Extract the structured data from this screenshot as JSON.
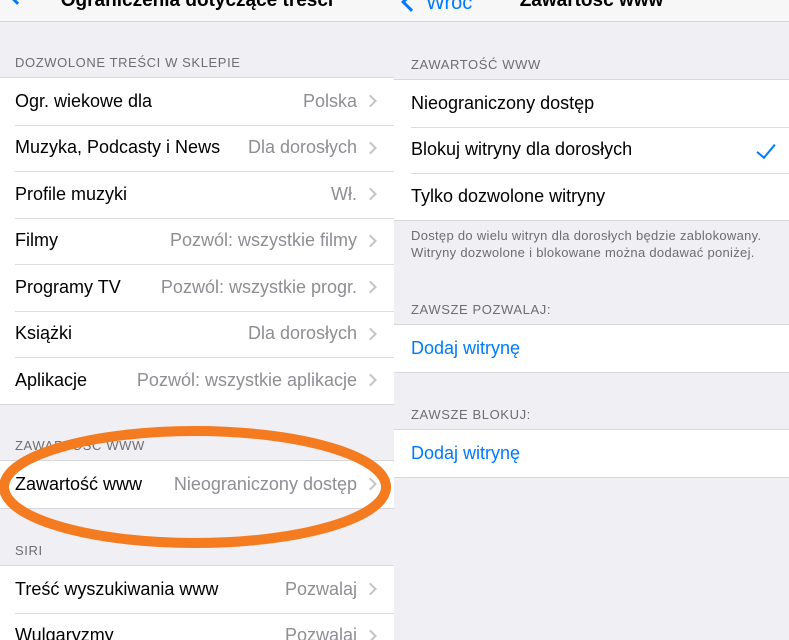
{
  "left": {
    "title": "Ograniczenia dotyczące treści",
    "store_section": {
      "header": "DOZWOLONE TREŚCI W SKLEPIE",
      "rows": [
        {
          "label": "Ogr. wiekowe dla",
          "value": "Polska"
        },
        {
          "label": "Muzyka, Podcasty i News",
          "value": "Dla dorosłych"
        },
        {
          "label": "Profile muzyki",
          "value": "Wł."
        },
        {
          "label": "Filmy",
          "value": "Pozwól: wszystkie filmy"
        },
        {
          "label": "Programy TV",
          "value": "Pozwól: wszystkie progr."
        },
        {
          "label": "Książki",
          "value": "Dla dorosłych"
        },
        {
          "label": "Aplikacje",
          "value": "Pozwól: wszystkie aplikacje"
        }
      ]
    },
    "web_section": {
      "header": "ZAWARTOŚĆ WWW",
      "rows": [
        {
          "label": "Zawartość www",
          "value": "Nieograniczony dostęp"
        }
      ]
    },
    "siri_section": {
      "header": "SIRI",
      "rows": [
        {
          "label": "Treść wyszukiwania www",
          "value": "Pozwalaj"
        },
        {
          "label": "Wulgaryzmy",
          "value": "Pozwalaj"
        }
      ]
    },
    "highlight_color": "#f47b20"
  },
  "right": {
    "back_label": "Wróć",
    "title": "Zawartość www",
    "web_section": {
      "header": "ZAWARTOŚĆ WWW",
      "options": [
        {
          "label": "Nieograniczony dostęp",
          "selected": false
        },
        {
          "label": "Blokuj witryny dla dorosłych",
          "selected": true
        },
        {
          "label": "Tylko dozwolone witryny",
          "selected": false
        }
      ],
      "footer": "Dostęp do wielu witryn dla dorosłych będzie zablokowany. Witryny dozwolone i blokowane można dodawać poniżej."
    },
    "always_allow": {
      "header": "ZAWSZE POZWALAJ:",
      "add_label": "Dodaj witrynę"
    },
    "always_block": {
      "header": "ZAWSZE BLOKUJ:",
      "add_label": "Dodaj witrynę"
    }
  },
  "colors": {
    "accent": "#007aff",
    "background": "#efeff4",
    "secondary_text": "#8e8e93"
  }
}
